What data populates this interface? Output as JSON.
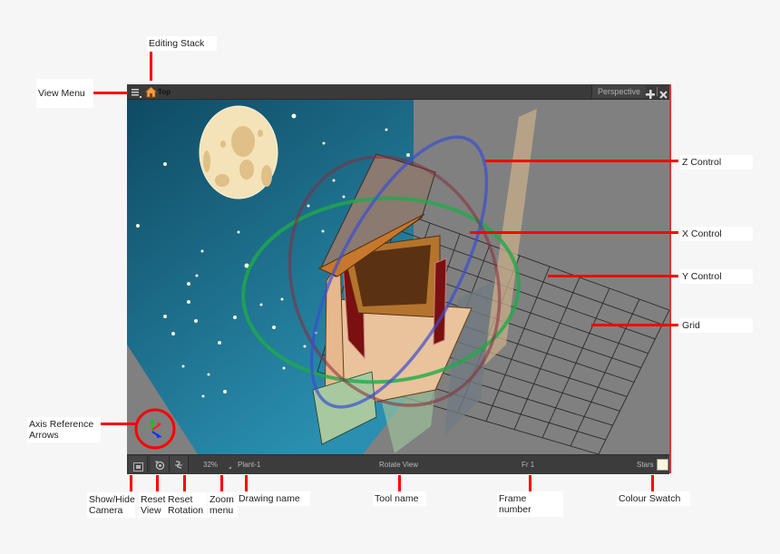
{
  "window": {
    "topbar": {
      "view_menu_icon": "hamburger-menu-icon",
      "editing_stack_icon": "home-icon",
      "editing_stack_label": "Top",
      "view_tab_label": "Perspective",
      "add_view_icon": "plus-icon",
      "close_view_icon": "close-icon"
    },
    "bottombar": {
      "show_hide_camera_icon": "camera-icon",
      "reset_view_icon": "reset-view-icon",
      "reset_rotation_icon": "reset-rotation-icon",
      "zoom_value": "32%",
      "drawing_name": "Plant-1",
      "tool_name": "Rotate View",
      "frame": "Fr 1",
      "colour_name": "Stars",
      "colour_swatch": "#fdf6dc"
    }
  },
  "scene": {
    "sky_colors": [
      "#0f4a62",
      "#2a8fb0"
    ],
    "floor_color": "#808080",
    "controls": {
      "x_color": "#c04050",
      "y_color": "#1faa4a",
      "z_color": "#3a4fd0"
    },
    "moon_color": "#f4e2b8"
  },
  "callouts": {
    "editing_stack": "Editing Stack",
    "view_menu": "View Menu",
    "axis_reference": [
      "Axis Reference",
      "Arrows"
    ],
    "z_control": "Z Control",
    "x_control": "X Control",
    "y_control": "Y Control",
    "grid": "Grid",
    "show_hide_camera": [
      "Show/Hide",
      "Camera"
    ],
    "reset_view": [
      "Reset",
      "View"
    ],
    "reset_rotation": [
      "Reset",
      "Rotation"
    ],
    "zoom_menu": [
      "Zoom",
      "menu"
    ],
    "drawing_name": "Drawing name",
    "tool_name": "Tool name",
    "frame_number": "Frame number",
    "colour_swatch": "Colour Swatch"
  }
}
